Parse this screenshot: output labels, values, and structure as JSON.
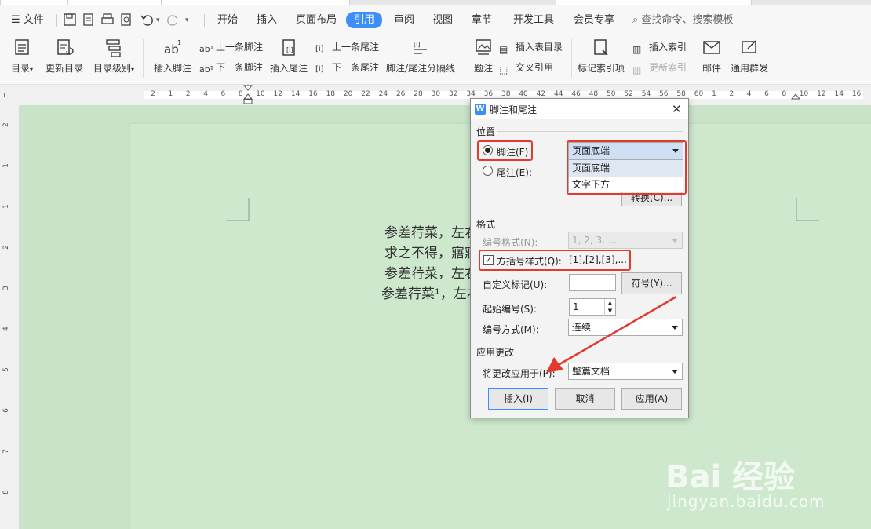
{
  "menubar": {
    "file": "文件",
    "tabs": [
      "开始",
      "插入",
      "页面布局",
      "引用",
      "审阅",
      "视图",
      "章节",
      "开发工具",
      "会员专享"
    ],
    "active_tab": "引用",
    "search_placeholder": "查找命令、搜索模板"
  },
  "ribbon": {
    "toc": "目录",
    "update_toc": "更新目录",
    "toc_level": "目录级别",
    "insert_footnote": "插入脚注",
    "prev_footnote": "上一条脚注",
    "next_footnote": "下一条脚注",
    "insert_endnote": "插入尾注",
    "prev_endnote": "上一条尾注",
    "next_endnote": "下一条尾注",
    "separator": "脚注/尾注分隔线",
    "caption": "题注",
    "insert_table_of_figures": "插入表目录",
    "cross_reference": "交叉引用",
    "mark_index": "标记索引项",
    "insert_index": "插入索引",
    "update_index": "更新索引",
    "mail": "邮件",
    "mass_mail": "通用群发"
  },
  "ruler": {
    "h_numbers": [
      "2",
      "1",
      "2",
      "4",
      "6",
      "8",
      "10",
      "12",
      "14",
      "16",
      "18",
      "20",
      "22",
      "24",
      "26",
      "28",
      "30",
      "32",
      "34",
      "36",
      "38",
      "40",
      "42",
      "44",
      "46",
      "48",
      "50",
      "52",
      "54",
      "56",
      "58",
      "60",
      "1",
      "2",
      "4",
      "6",
      "8",
      "10",
      "12",
      "14",
      "16"
    ],
    "v_numbers": [
      "2",
      "1",
      "1",
      "2",
      "3",
      "4",
      "5",
      "6",
      "7",
      "8"
    ]
  },
  "document": {
    "lines": [
      "参差荇菜，左右",
      "求之不得，寤寐",
      "参差荇菜，左右",
      "参差荇菜¹，左右"
    ]
  },
  "dialog": {
    "title": "脚注和尾注",
    "close": "✕",
    "section_position": "位置",
    "footnote_label": "脚注(F):",
    "endnote_label": "尾注(E):",
    "footnote_location": "页面底端",
    "location_options": [
      "页面底端",
      "文字下方"
    ],
    "convert_button": "转换(C)...",
    "section_format": "格式",
    "number_format_label": "编号格式(N):",
    "number_format_value": "1, 2, 3, ...",
    "bracket_style_label": "方括号样式(Q):",
    "bracket_style_value": "[1],[2],[3],...",
    "custom_mark_label": "自定义标记(U):",
    "custom_mark_value": "",
    "symbol_button": "符号(Y)...",
    "start_at_label": "起始编号(S):",
    "start_at_value": "1",
    "numbering_label": "编号方式(M):",
    "numbering_value": "连续",
    "section_apply": "应用更改",
    "apply_to_label": "将更改应用于(P):",
    "apply_to_value": "整篇文档",
    "insert_button": "插入(I)",
    "cancel_button": "取消",
    "apply_button": "应用(A)"
  },
  "watermark": {
    "logo": "Bai 经验",
    "url": "jingyan.baidu.com"
  },
  "colors": {
    "accent": "#3e8ef7",
    "highlight": "#e23a2e",
    "page": "#cde8cc"
  }
}
